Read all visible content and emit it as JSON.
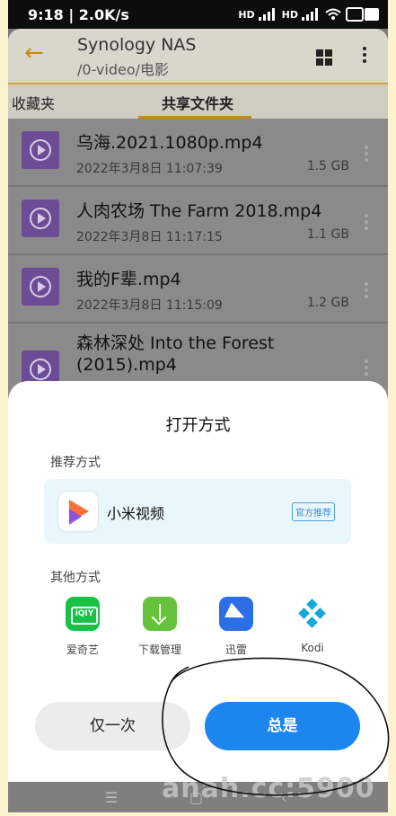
{
  "status_bar": {
    "time": "9:18 | 2.0K/s",
    "net_label_1": "HD",
    "net_label_2": "HD"
  },
  "app_bar": {
    "title": "Synology NAS",
    "path": "/0-video/电影",
    "back_icon": "arrow-left-icon",
    "view_icon": "grid-icon",
    "more_icon": "more-vertical-icon",
    "accent_color": "#c58a14"
  },
  "tabs": [
    {
      "label": "收藏夹",
      "selected": false
    },
    {
      "label": "共享文件夹",
      "selected": true
    }
  ],
  "files": [
    {
      "name": "乌海.2021.1080p.mp4",
      "date": "2022年3月8日 11:07:39",
      "size": "1.5 GB"
    },
    {
      "name": "人肉农场 The Farm 2018.mp4",
      "date": "2022年3月8日 11:17:15",
      "size": "1.1 GB"
    },
    {
      "name": "我的F辈.mp4",
      "date": "2022年3月8日 11:15:09",
      "size": "1.2 GB"
    },
    {
      "name": "森林深处 Into the Forest (2015).mp4",
      "date": "",
      "size": ""
    }
  ],
  "open_with_sheet": {
    "title": "打开方式",
    "recommended_label": "推荐方式",
    "recommended_app": {
      "name": "小米视频",
      "badge": "官方推荐",
      "icon": "mi-video-icon"
    },
    "others_label": "其他方式",
    "other_apps": [
      {
        "name": "爱奇艺",
        "icon": "iqiyi-icon"
      },
      {
        "name": "下载管理",
        "icon": "download-manager-icon"
      },
      {
        "name": "迅雷",
        "icon": "xunlei-icon"
      },
      {
        "name": "Kodi",
        "icon": "kodi-icon"
      }
    ],
    "once_label": "仅一次",
    "always_label": "总是",
    "primary_color": "#1c86ee"
  },
  "nav_bar": {
    "menu": "☰",
    "home": "▢",
    "back": "‹"
  },
  "watermark": "anah.cc:5900"
}
